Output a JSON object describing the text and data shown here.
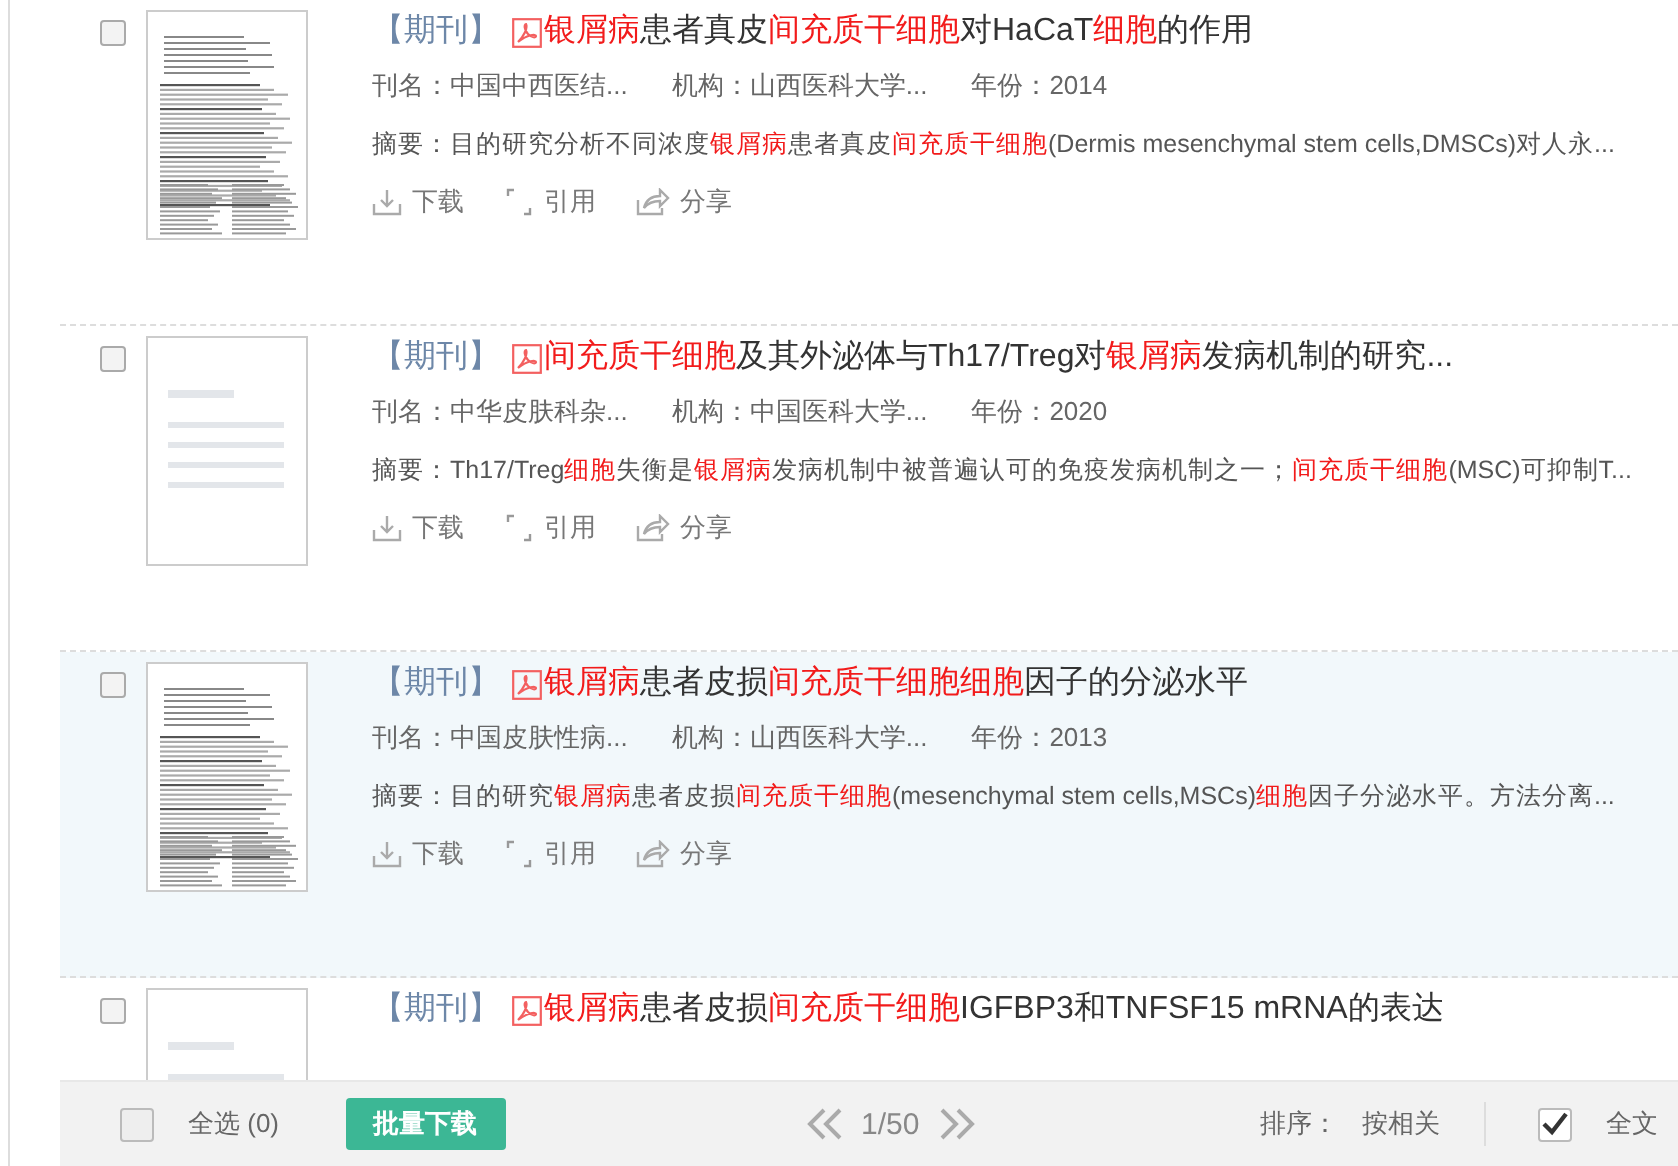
{
  "results": [
    {
      "checked": false,
      "highlighted": false,
      "thumbnail": {
        "kind": "scan"
      },
      "tag": "【期刊】",
      "title": [
        {
          "text": "银屑病",
          "hit": true
        },
        {
          "text": "患者真皮",
          "hit": false
        },
        {
          "text": "间充质干细胞",
          "hit": true
        },
        {
          "text": "对HaCaT",
          "hit": false
        },
        {
          "text": "细胞",
          "hit": true
        },
        {
          "text": "的作用",
          "hit": false
        }
      ],
      "journal": "刊名：中国中西医结...",
      "institution": "机构：山西医科大学...",
      "year": "年份：2014",
      "abstract": [
        {
          "text": "摘要：目的研究分析不同浓度",
          "hit": false
        },
        {
          "text": "银屑病",
          "hit": true
        },
        {
          "text": "患者真皮",
          "hit": false
        },
        {
          "text": "间充质干细胞",
          "hit": true
        },
        {
          "text": "(Dermis mesenchymal stem cells,DMSCs)对人永...",
          "hit": false
        }
      ],
      "actions": [
        "下载",
        "引用",
        "分享"
      ]
    },
    {
      "checked": false,
      "highlighted": false,
      "thumbnail": {
        "kind": "blank"
      },
      "tag": "【期刊】",
      "title": [
        {
          "text": "间充质干细胞",
          "hit": true
        },
        {
          "text": "及其外泌体与Th17/Treg对",
          "hit": false
        },
        {
          "text": "银屑病",
          "hit": true
        },
        {
          "text": "发病机制的研究...",
          "hit": false
        }
      ],
      "journal": "刊名：中华皮肤科杂...",
      "institution": "机构：中国医科大学...",
      "year": "年份：2020",
      "abstract": [
        {
          "text": "摘要：Th17/Treg",
          "hit": false
        },
        {
          "text": "细胞",
          "hit": true
        },
        {
          "text": "失衡是",
          "hit": false
        },
        {
          "text": "银屑病",
          "hit": true
        },
        {
          "text": "发病机制中被普遍认可的免疫发病机制之一；",
          "hit": false
        },
        {
          "text": "间充质干细胞",
          "hit": true
        },
        {
          "text": "(MSC)可抑制T...",
          "hit": false
        }
      ],
      "actions": [
        "下载",
        "引用",
        "分享"
      ]
    },
    {
      "checked": false,
      "highlighted": true,
      "thumbnail": {
        "kind": "scan"
      },
      "tag": "【期刊】",
      "title": [
        {
          "text": "银屑病",
          "hit": true
        },
        {
          "text": "患者皮损",
          "hit": false
        },
        {
          "text": "间充质干细胞细胞",
          "hit": true
        },
        {
          "text": "因子的分泌水平",
          "hit": false
        }
      ],
      "journal": "刊名：中国皮肤性病...",
      "institution": "机构：山西医科大学...",
      "year": "年份：2013",
      "abstract": [
        {
          "text": "摘要：目的研究",
          "hit": false
        },
        {
          "text": "银屑病",
          "hit": true
        },
        {
          "text": "患者皮损",
          "hit": false
        },
        {
          "text": "间充质干细胞",
          "hit": true
        },
        {
          "text": "(mesenchymal stem cells,MSCs)",
          "hit": false
        },
        {
          "text": "细胞",
          "hit": true
        },
        {
          "text": "因子分泌水平。方法分离...",
          "hit": false
        }
      ],
      "actions": [
        "下载",
        "引用",
        "分享"
      ]
    },
    {
      "checked": false,
      "highlighted": false,
      "thumbnail": {
        "kind": "blank"
      },
      "tag": "【期刊】",
      "title": [
        {
          "text": "银屑病",
          "hit": true
        },
        {
          "text": "患者皮损",
          "hit": false
        },
        {
          "text": "间充质干细胞",
          "hit": true
        },
        {
          "text": "IGFBP3和TNFSF15 mRNA的表达",
          "hit": false
        }
      ]
    }
  ],
  "footer": {
    "select_all": {
      "checked": false,
      "label": "全选 (0)"
    },
    "batch_download": "批量下载",
    "page": "1/50",
    "sort_label": "排序：",
    "sort_value": "按相关",
    "full_text": {
      "checked": true,
      "label": "全文"
    }
  }
}
